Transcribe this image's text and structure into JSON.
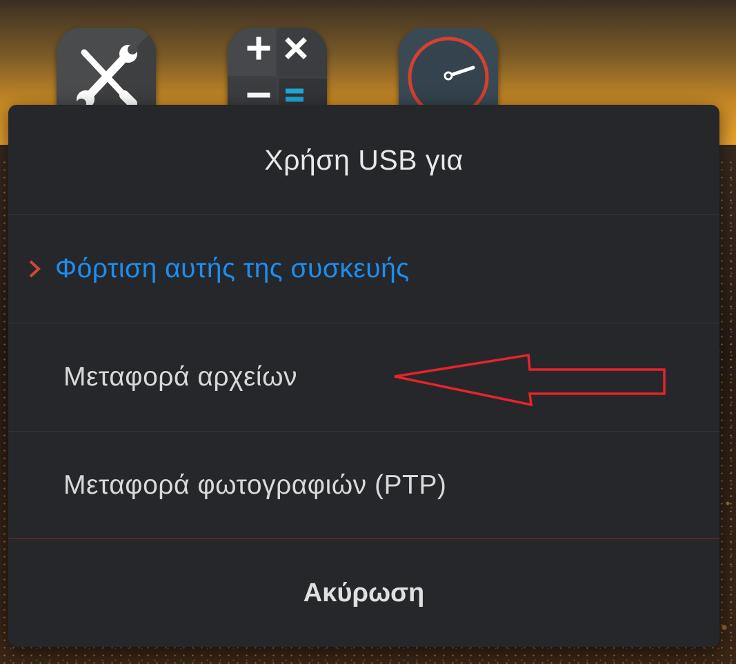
{
  "dialog": {
    "title": "Χρήση USB για",
    "options": [
      {
        "label": "Φόρτιση αυτής της συσκευής",
        "selected": true
      },
      {
        "label": "Μεταφορά αρχείων",
        "selected": false
      },
      {
        "label": "Μεταφορά φωτογραφιών (PTP)",
        "selected": false
      }
    ],
    "cancel_label": "Ακύρωση"
  },
  "home_icons": [
    "tools-icon",
    "calculator-icon",
    "clock-icon"
  ],
  "colors": {
    "dialog_background": "#26272b",
    "selected_text": "#1c8ef0",
    "selection_chevron": "#d0473a",
    "annotation_arrow": "#e8232b"
  }
}
